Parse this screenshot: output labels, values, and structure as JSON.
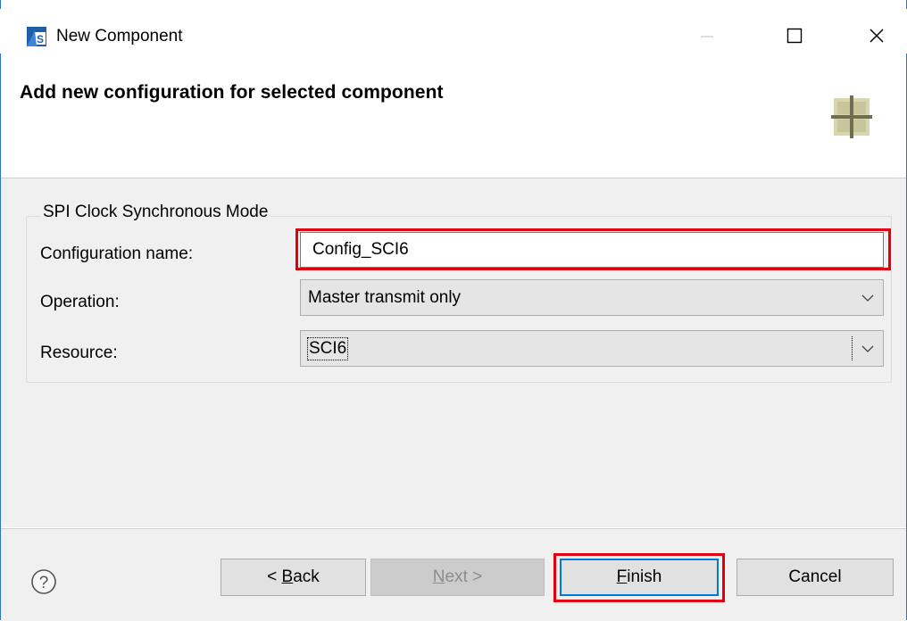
{
  "window": {
    "title": "New Component",
    "minimize_glyph": "—",
    "maximize_glyph": "☐",
    "close_glyph": "✕"
  },
  "banner": {
    "title": "Add new configuration for selected component",
    "icon": "component-grid-icon"
  },
  "form": {
    "group_title": "SPI Clock Synchronous Mode",
    "config_name": {
      "label": "Configuration name:",
      "value": "Config_SCI6"
    },
    "operation": {
      "label": "Operation:",
      "value": "Master transmit only"
    },
    "resource": {
      "label": "Resource:",
      "value": "SCI6"
    }
  },
  "buttons": {
    "help_icon": "help-question-icon",
    "back": {
      "prefix": "< ",
      "mnemonic": "B",
      "rest": "ack"
    },
    "next": {
      "mnemonic": "N",
      "rest": "ext >"
    },
    "finish": {
      "mnemonic": "F",
      "rest": "inish"
    },
    "cancel": "Cancel"
  },
  "colors": {
    "window_border": "#2b74c7",
    "highlight_red": "#e0000f",
    "focus_blue": "#0078d7",
    "dialog_bg": "#f0f0f0"
  }
}
